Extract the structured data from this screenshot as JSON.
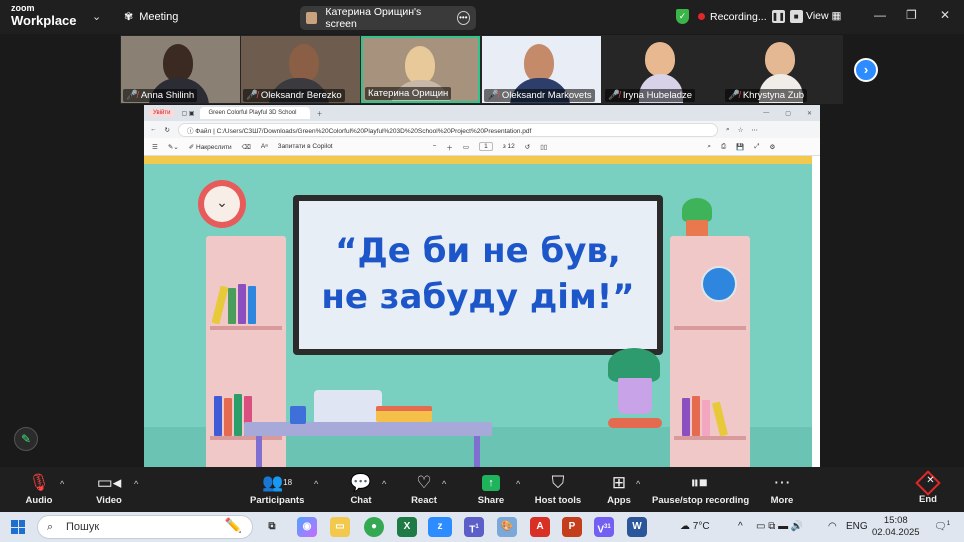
{
  "app": {
    "logo_line1": "zoom",
    "logo_line2": "Workplace",
    "meeting_label": "Meeting",
    "screen_share_title": "Катерина Орищин's screen",
    "recording_label": "Recording...",
    "view_label": "View"
  },
  "participants": [
    {
      "name": "Anna Shilinh",
      "muted": true
    },
    {
      "name": "Oleksandr Berezko",
      "muted": true
    },
    {
      "name": "Катерина Орищин",
      "muted": false,
      "active": true
    },
    {
      "name": "Oleksandr Markovets",
      "muted": true
    },
    {
      "name": "Iryna Hubeladze",
      "muted": true
    },
    {
      "name": "Khrystyna Zub",
      "muted": true
    }
  ],
  "shared_screen": {
    "browser_back_label": "Увійти",
    "tab_title": "Green Colorful Playful 3D School",
    "url_prefix": "Файл",
    "url": "C:/Users/СЗШ7/Downloads/Green%20Colorful%20Playful%203D%20School%20Project%20Presentation.pdf",
    "pdf_draw_label": "Накреслити",
    "pdf_copilot_label": "Запитати в Copilot",
    "pdf_page": "1",
    "pdf_page_total": "з 12",
    "slide_line1": "“Де би не був,",
    "slide_line2": "не забуду дім!”"
  },
  "controls": {
    "audio": "Audio",
    "video": "Video",
    "participants": "Participants",
    "participants_count": "18",
    "chat": "Chat",
    "react": "React",
    "share": "Share",
    "host_tools": "Host tools",
    "apps": "Apps",
    "pause_recording": "Pause/stop recording",
    "more": "More",
    "end": "End"
  },
  "taskbar": {
    "search_placeholder": "Пошук",
    "weather": "7°C",
    "language": "ENG",
    "time": "15:08",
    "date": "02.04.2025",
    "teams_badge": "1",
    "viber_badge": "31",
    "notification_badge": "1"
  },
  "colors": {
    "zoom_blue": "#2d8cff",
    "recording_red": "#e02828",
    "share_green": "#1fb35b",
    "active_speaker": "#31c48d",
    "slide_background": "#79cfc0",
    "slide_text": "#1d56c8"
  }
}
